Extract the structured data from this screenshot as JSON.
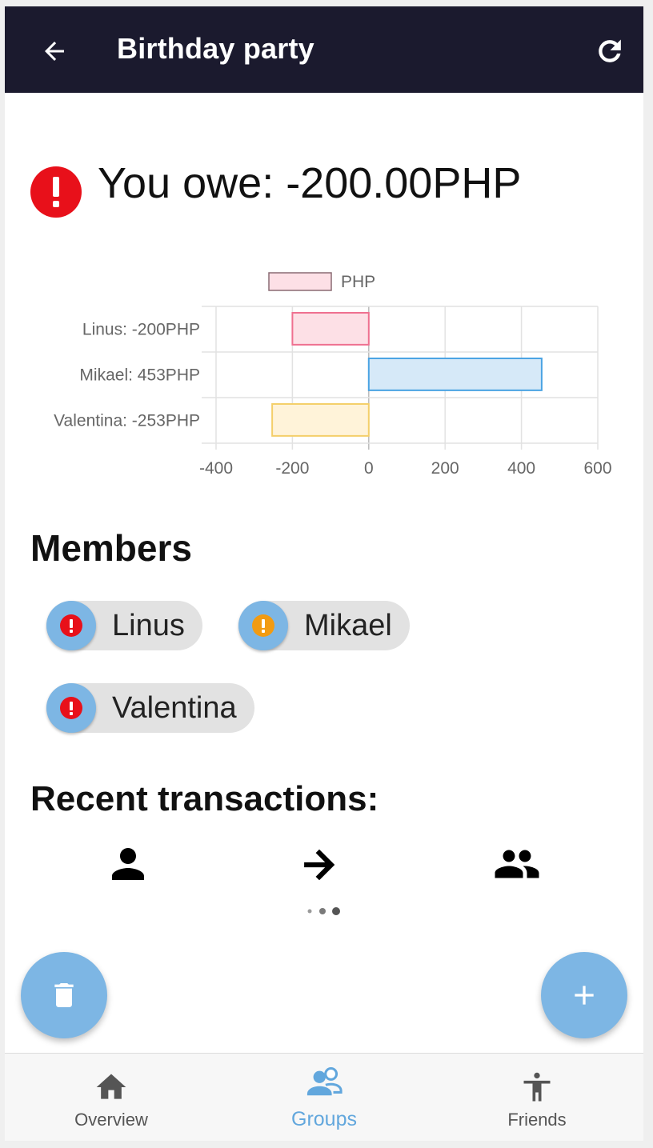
{
  "appbar": {
    "title": "Birthday party",
    "back_icon": "arrow-left-icon",
    "refresh_icon": "refresh-icon"
  },
  "summary": {
    "text": "You owe: -200.00PHP",
    "status_icon": "alert-circle-icon",
    "status_color": "#e8101a"
  },
  "chart_data": {
    "type": "bar",
    "orientation": "horizontal",
    "categories": [
      "Linus: -200PHP",
      "Mikael: 453PHP",
      "Valentina: -253PHP"
    ],
    "series": [
      {
        "name": "PHP",
        "values": [
          -200,
          453,
          -253
        ]
      }
    ],
    "xlim": [
      -400,
      600
    ],
    "x_ticks": [
      "-400",
      "-200",
      "0",
      "200",
      "400",
      "600"
    ],
    "grid": true,
    "legend": "top",
    "colors": {
      "fills": [
        "#fde0e6",
        "#d6e9f8",
        "#fff3d9"
      ],
      "strokes": [
        "#ef7090",
        "#4aa3e3",
        "#f4cf6a"
      ],
      "legend_fill": "#fde0e6",
      "legend_stroke": "#8a6b73"
    }
  },
  "members": {
    "title": "Members",
    "items": [
      {
        "name": "Linus",
        "status_color": "#e8101a"
      },
      {
        "name": "Mikael",
        "status_color": "#f29b12"
      },
      {
        "name": "Valentina",
        "status_color": "#e8101a"
      }
    ]
  },
  "transactions": {
    "title": "Recent transactions:",
    "icons": [
      "person-icon",
      "arrow-right-icon",
      "group-icon"
    ]
  },
  "actions": {
    "delete_icon": "trash-icon",
    "add_icon": "plus-icon",
    "fab_color": "#7db6e4"
  },
  "bottom_nav": {
    "items": [
      {
        "label": "Overview",
        "icon": "home-icon"
      },
      {
        "label": "Groups",
        "icon": "groups-icon",
        "active": true
      },
      {
        "label": "Friends",
        "icon": "person-standing-icon"
      }
    ]
  }
}
